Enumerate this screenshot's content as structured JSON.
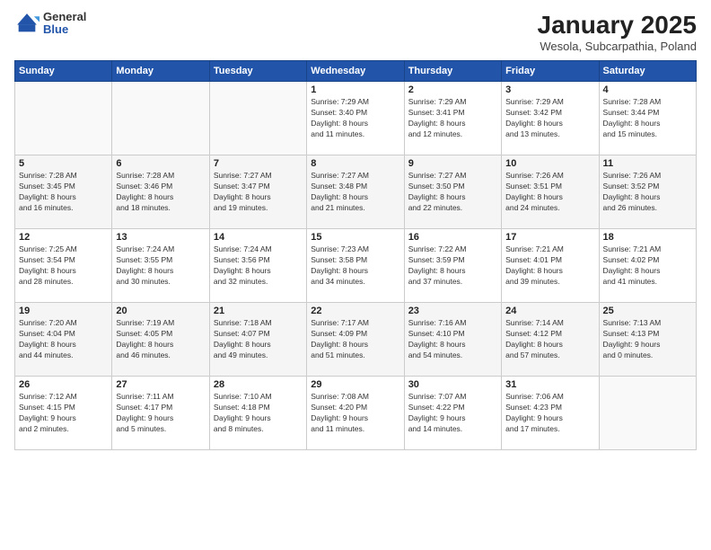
{
  "logo": {
    "general": "General",
    "blue": "Blue"
  },
  "header": {
    "month": "January 2025",
    "location": "Wesola, Subcarpathia, Poland"
  },
  "weekdays": [
    "Sunday",
    "Monday",
    "Tuesday",
    "Wednesday",
    "Thursday",
    "Friday",
    "Saturday"
  ],
  "weeks": [
    [
      {
        "day": "",
        "content": ""
      },
      {
        "day": "",
        "content": ""
      },
      {
        "day": "",
        "content": ""
      },
      {
        "day": "1",
        "content": "Sunrise: 7:29 AM\nSunset: 3:40 PM\nDaylight: 8 hours\nand 11 minutes."
      },
      {
        "day": "2",
        "content": "Sunrise: 7:29 AM\nSunset: 3:41 PM\nDaylight: 8 hours\nand 12 minutes."
      },
      {
        "day": "3",
        "content": "Sunrise: 7:29 AM\nSunset: 3:42 PM\nDaylight: 8 hours\nand 13 minutes."
      },
      {
        "day": "4",
        "content": "Sunrise: 7:28 AM\nSunset: 3:44 PM\nDaylight: 8 hours\nand 15 minutes."
      }
    ],
    [
      {
        "day": "5",
        "content": "Sunrise: 7:28 AM\nSunset: 3:45 PM\nDaylight: 8 hours\nand 16 minutes."
      },
      {
        "day": "6",
        "content": "Sunrise: 7:28 AM\nSunset: 3:46 PM\nDaylight: 8 hours\nand 18 minutes."
      },
      {
        "day": "7",
        "content": "Sunrise: 7:27 AM\nSunset: 3:47 PM\nDaylight: 8 hours\nand 19 minutes."
      },
      {
        "day": "8",
        "content": "Sunrise: 7:27 AM\nSunset: 3:48 PM\nDaylight: 8 hours\nand 21 minutes."
      },
      {
        "day": "9",
        "content": "Sunrise: 7:27 AM\nSunset: 3:50 PM\nDaylight: 8 hours\nand 22 minutes."
      },
      {
        "day": "10",
        "content": "Sunrise: 7:26 AM\nSunset: 3:51 PM\nDaylight: 8 hours\nand 24 minutes."
      },
      {
        "day": "11",
        "content": "Sunrise: 7:26 AM\nSunset: 3:52 PM\nDaylight: 8 hours\nand 26 minutes."
      }
    ],
    [
      {
        "day": "12",
        "content": "Sunrise: 7:25 AM\nSunset: 3:54 PM\nDaylight: 8 hours\nand 28 minutes."
      },
      {
        "day": "13",
        "content": "Sunrise: 7:24 AM\nSunset: 3:55 PM\nDaylight: 8 hours\nand 30 minutes."
      },
      {
        "day": "14",
        "content": "Sunrise: 7:24 AM\nSunset: 3:56 PM\nDaylight: 8 hours\nand 32 minutes."
      },
      {
        "day": "15",
        "content": "Sunrise: 7:23 AM\nSunset: 3:58 PM\nDaylight: 8 hours\nand 34 minutes."
      },
      {
        "day": "16",
        "content": "Sunrise: 7:22 AM\nSunset: 3:59 PM\nDaylight: 8 hours\nand 37 minutes."
      },
      {
        "day": "17",
        "content": "Sunrise: 7:21 AM\nSunset: 4:01 PM\nDaylight: 8 hours\nand 39 minutes."
      },
      {
        "day": "18",
        "content": "Sunrise: 7:21 AM\nSunset: 4:02 PM\nDaylight: 8 hours\nand 41 minutes."
      }
    ],
    [
      {
        "day": "19",
        "content": "Sunrise: 7:20 AM\nSunset: 4:04 PM\nDaylight: 8 hours\nand 44 minutes."
      },
      {
        "day": "20",
        "content": "Sunrise: 7:19 AM\nSunset: 4:05 PM\nDaylight: 8 hours\nand 46 minutes."
      },
      {
        "day": "21",
        "content": "Sunrise: 7:18 AM\nSunset: 4:07 PM\nDaylight: 8 hours\nand 49 minutes."
      },
      {
        "day": "22",
        "content": "Sunrise: 7:17 AM\nSunset: 4:09 PM\nDaylight: 8 hours\nand 51 minutes."
      },
      {
        "day": "23",
        "content": "Sunrise: 7:16 AM\nSunset: 4:10 PM\nDaylight: 8 hours\nand 54 minutes."
      },
      {
        "day": "24",
        "content": "Sunrise: 7:14 AM\nSunset: 4:12 PM\nDaylight: 8 hours\nand 57 minutes."
      },
      {
        "day": "25",
        "content": "Sunrise: 7:13 AM\nSunset: 4:13 PM\nDaylight: 9 hours\nand 0 minutes."
      }
    ],
    [
      {
        "day": "26",
        "content": "Sunrise: 7:12 AM\nSunset: 4:15 PM\nDaylight: 9 hours\nand 2 minutes."
      },
      {
        "day": "27",
        "content": "Sunrise: 7:11 AM\nSunset: 4:17 PM\nDaylight: 9 hours\nand 5 minutes."
      },
      {
        "day": "28",
        "content": "Sunrise: 7:10 AM\nSunset: 4:18 PM\nDaylight: 9 hours\nand 8 minutes."
      },
      {
        "day": "29",
        "content": "Sunrise: 7:08 AM\nSunset: 4:20 PM\nDaylight: 9 hours\nand 11 minutes."
      },
      {
        "day": "30",
        "content": "Sunrise: 7:07 AM\nSunset: 4:22 PM\nDaylight: 9 hours\nand 14 minutes."
      },
      {
        "day": "31",
        "content": "Sunrise: 7:06 AM\nSunset: 4:23 PM\nDaylight: 9 hours\nand 17 minutes."
      },
      {
        "day": "",
        "content": ""
      }
    ]
  ]
}
